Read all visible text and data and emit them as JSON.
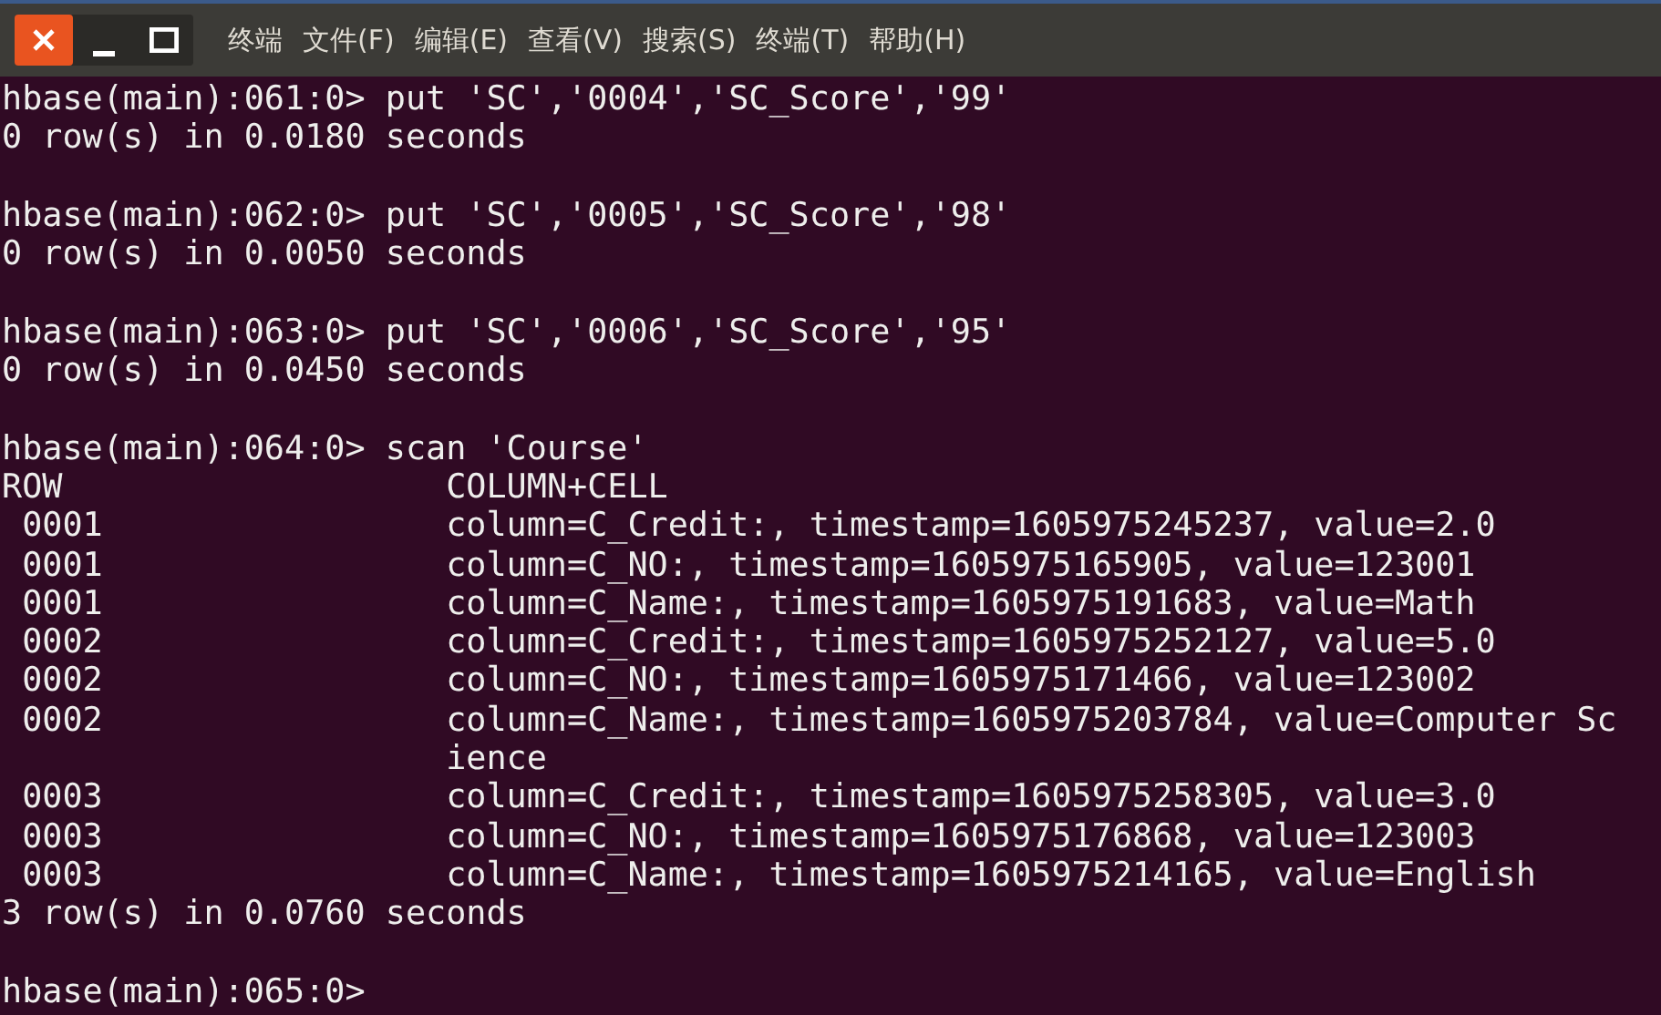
{
  "window": {
    "menu": [
      {
        "label": "终端"
      },
      {
        "label": "文件(F)"
      },
      {
        "label": "编辑(E)"
      },
      {
        "label": "查看(V)"
      },
      {
        "label": "搜索(S)"
      },
      {
        "label": "终端(T)"
      },
      {
        "label": "帮助(H)"
      }
    ]
  },
  "terminal": {
    "lines": [
      {
        "kind": "text",
        "text": "hbase(main):061:0> put 'SC','0004','SC_Score','99'"
      },
      {
        "kind": "text",
        "text": "0 row(s) in 0.0180 seconds"
      },
      {
        "kind": "blank"
      },
      {
        "kind": "text",
        "text": "hbase(main):062:0> put 'SC','0005','SC_Score','98'"
      },
      {
        "kind": "text",
        "text": "0 row(s) in 0.0050 seconds"
      },
      {
        "kind": "blank"
      },
      {
        "kind": "text",
        "text": "hbase(main):063:0> put 'SC','0006','SC_Score','95'"
      },
      {
        "kind": "text",
        "text": "0 row(s) in 0.0450 seconds"
      },
      {
        "kind": "blank"
      },
      {
        "kind": "text",
        "text": "hbase(main):064:0> scan 'Course'"
      },
      {
        "kind": "header",
        "row": "ROW",
        "cell": "COLUMN+CELL"
      },
      {
        "kind": "row",
        "row": "0001",
        "cell": "column=C_Credit:, timestamp=1605975245237, value=2.0"
      },
      {
        "kind": "row",
        "row": "0001",
        "cell": "column=C_NO:, timestamp=1605975165905, value=123001"
      },
      {
        "kind": "row",
        "row": "0001",
        "cell": "column=C_Name:, timestamp=1605975191683, value=Math"
      },
      {
        "kind": "row",
        "row": "0002",
        "cell": "column=C_Credit:, timestamp=1605975252127, value=5.0"
      },
      {
        "kind": "row",
        "row": "0002",
        "cell": "column=C_NO:, timestamp=1605975171466, value=123002"
      },
      {
        "kind": "row",
        "row": "0002",
        "cell": "column=C_Name:, timestamp=1605975203784, value=Computer Science"
      },
      {
        "kind": "row",
        "row": "0003",
        "cell": "column=C_Credit:, timestamp=1605975258305, value=3.0"
      },
      {
        "kind": "row",
        "row": "0003",
        "cell": "column=C_NO:, timestamp=1605975176868, value=123003"
      },
      {
        "kind": "row",
        "row": "0003",
        "cell": "column=C_Name:, timestamp=1605975214165, value=English"
      },
      {
        "kind": "text",
        "text": "3 row(s) in 0.0760 seconds"
      },
      {
        "kind": "blank"
      },
      {
        "kind": "text",
        "text": "hbase(main):065:0>"
      }
    ]
  }
}
